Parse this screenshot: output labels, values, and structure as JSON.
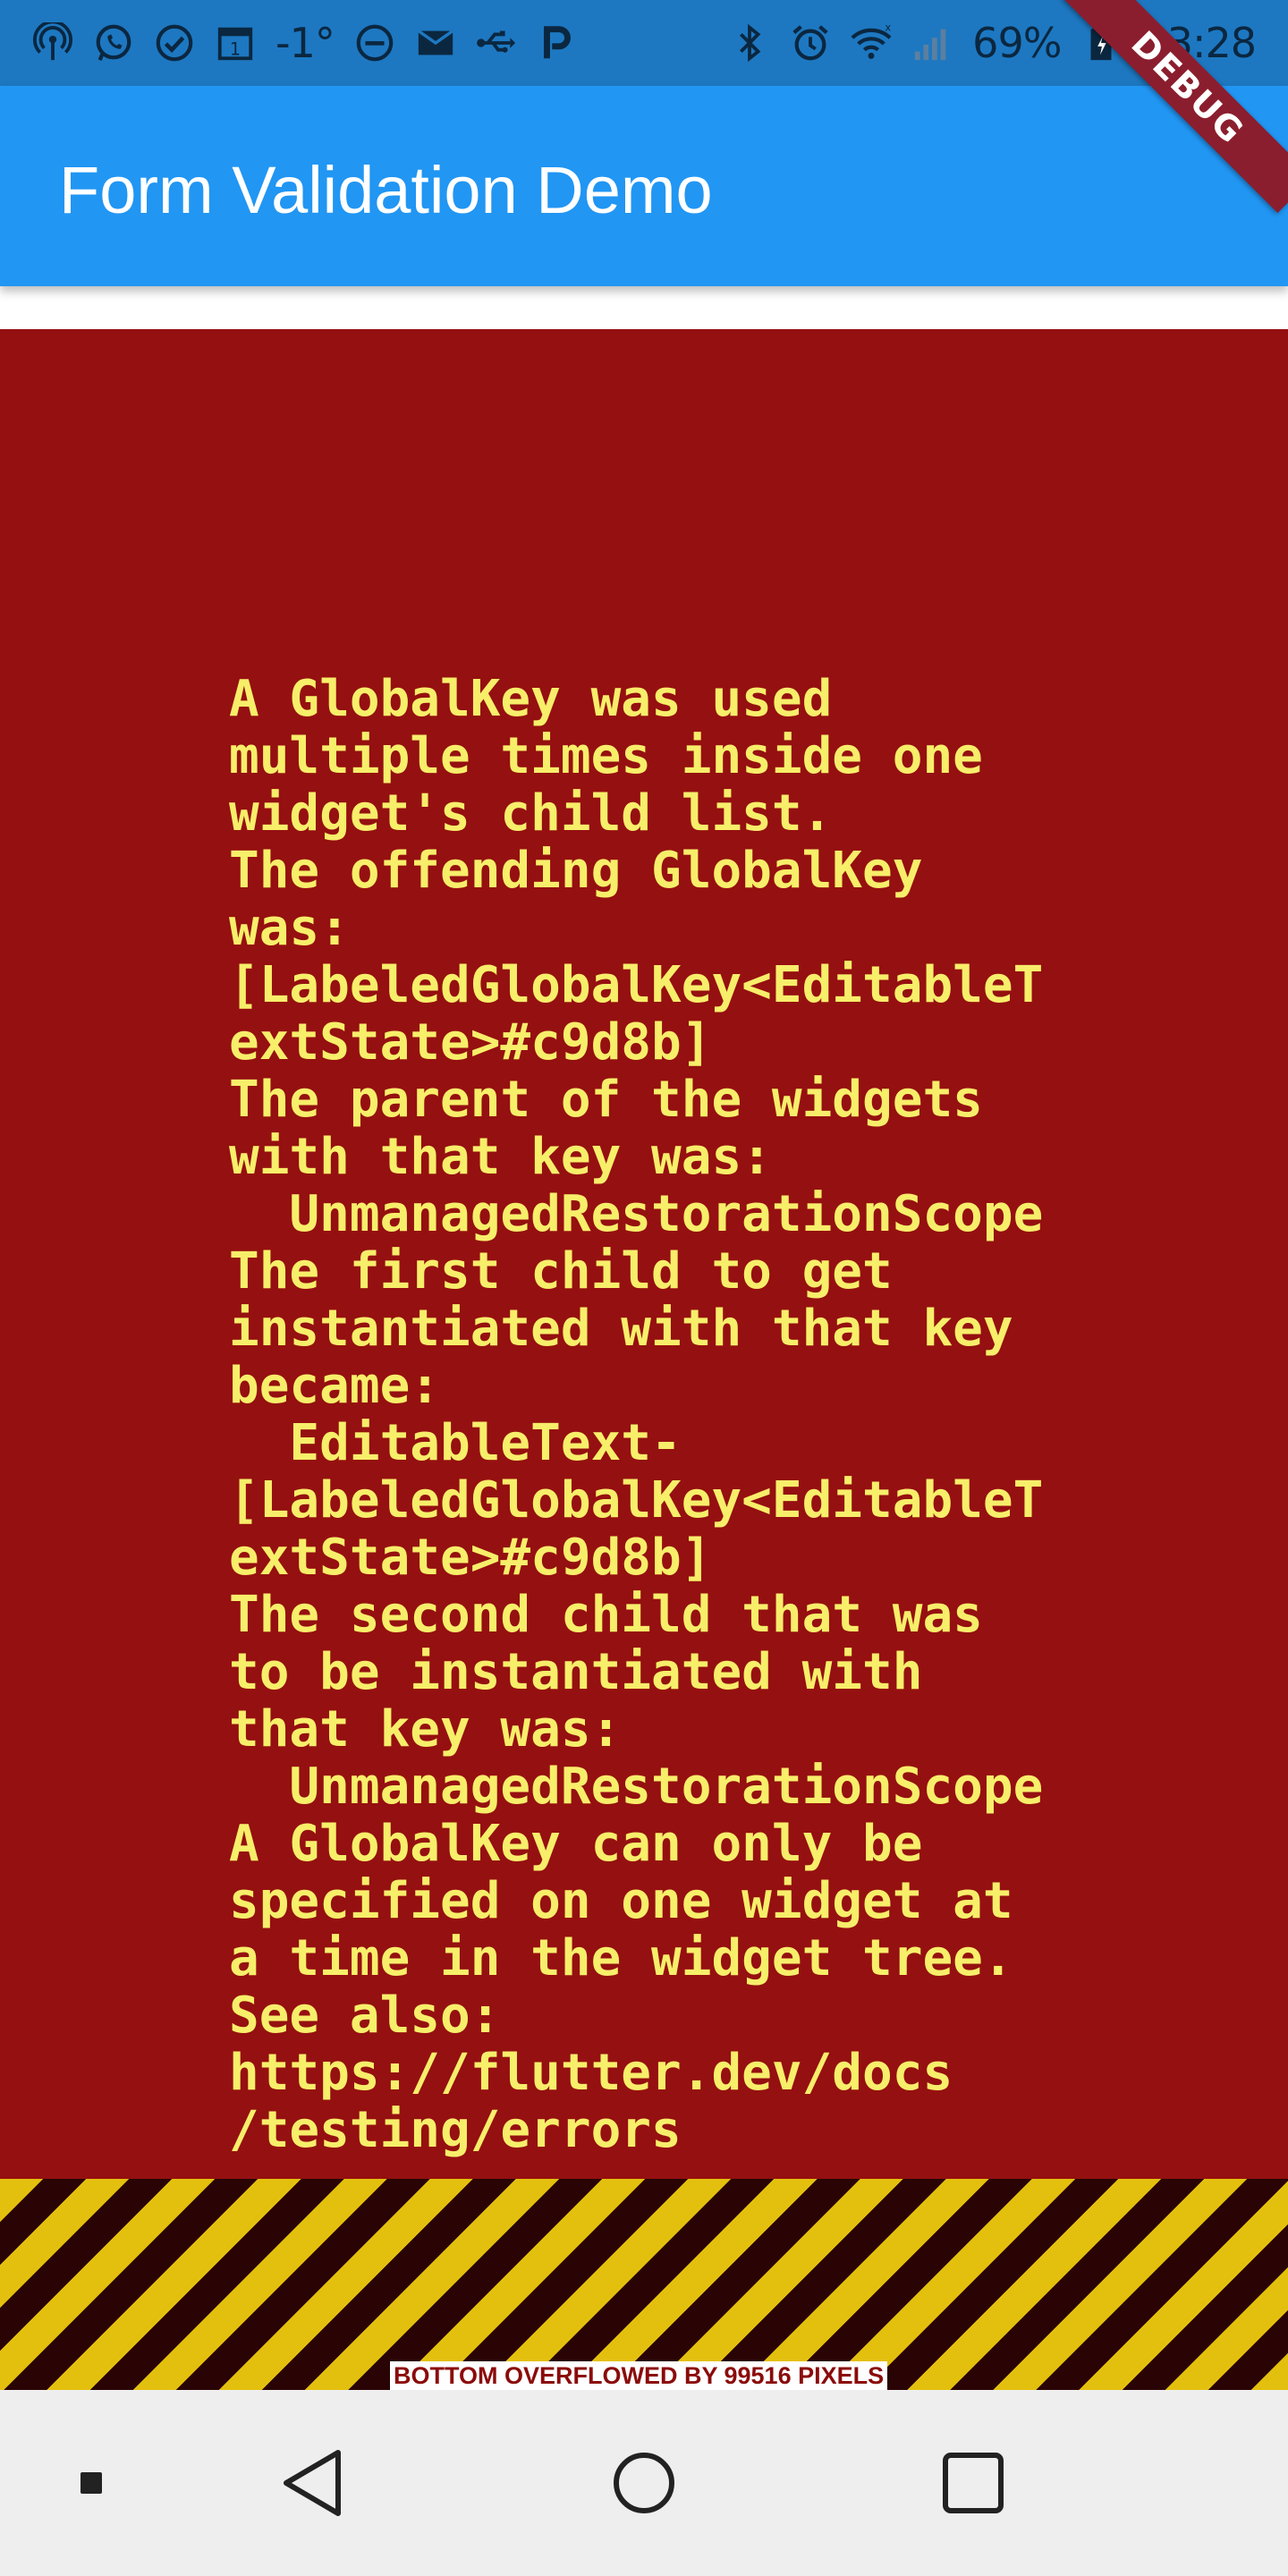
{
  "status_bar": {
    "left_icons": [
      "broadcast-icon",
      "whatsapp-icon",
      "check-circle-icon",
      "calendar-icon"
    ],
    "calendar_day": "1",
    "temperature": "-1°",
    "mid_icons": [
      "do-not-disturb-icon",
      "mail-icon",
      "usb-icon",
      "parking-icon"
    ],
    "right_icons": [
      "bluetooth-icon",
      "alarm-icon",
      "wifi-icon",
      "signal-icon",
      "battery-icon"
    ],
    "battery": "69%",
    "time": "23:28"
  },
  "debug_banner": {
    "label": "DEBUG"
  },
  "app_bar": {
    "title": "Form Validation Demo"
  },
  "error": {
    "message": "A GlobalKey was used\nmultiple times inside one\nwidget's child list.\nThe offending GlobalKey\nwas:\n[LabeledGlobalKey<EditableT\nextState>#c9d8b]\nThe parent of the widgets\nwith that key was:\n  UnmanagedRestorationScope\nThe first child to get\ninstantiated with that key\nbecame:\n  EditableText-\n[LabeledGlobalKey<EditableT\nextState>#c9d8b]\nThe second child that was\nto be instantiated with\nthat key was:\n  UnmanagedRestorationScope\nA GlobalKey can only be\nspecified on one widget at\na time in the widget tree.\nSee also:\nhttps://flutter.dev/docs\n/testing/errors"
  },
  "overflow": {
    "label": "BOTTOM OVERFLOWED BY 99516 PIXELS"
  },
  "nav_bar": {
    "buttons": [
      "recent-apps-icon",
      "back-icon",
      "home-icon",
      "overview-icon"
    ]
  },
  "colors": {
    "status_bar": "#1d78c1",
    "app_bar": "#2196f3",
    "error_bg": "#951010",
    "error_text": "#f7ee6a",
    "stripe_yellow": "#e4c00e",
    "stripe_dark": "#2a0404",
    "nav_bar": "#eeeeee"
  }
}
